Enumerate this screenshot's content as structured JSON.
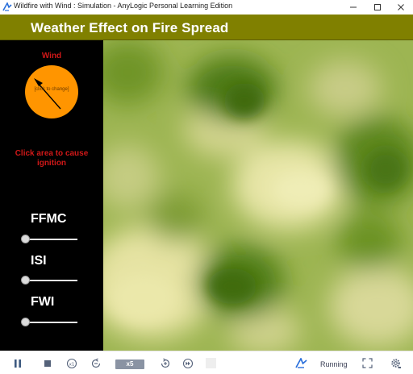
{
  "window": {
    "title": "Wildfire with Wind : Simulation - AnyLogic Personal Learning Edition"
  },
  "header": {
    "title": "Weather Effect on Fire Spread"
  },
  "left_panel": {
    "wind": {
      "label": "Wind",
      "click_hint": "[click to change]"
    },
    "ignition_hint": "Click area to cause ignition",
    "parameters": [
      {
        "label": "FFMC"
      },
      {
        "label": "ISI"
      },
      {
        "label": "FWI"
      }
    ]
  },
  "toolbar": {
    "speed": "x5",
    "status": "Running"
  },
  "colors": {
    "header_band": "#808000",
    "panel": "#000000",
    "dial": "#ff9500",
    "label_red": "#d01818",
    "map_light": "#e8e4a4",
    "map_dark": "#4f7a10"
  }
}
